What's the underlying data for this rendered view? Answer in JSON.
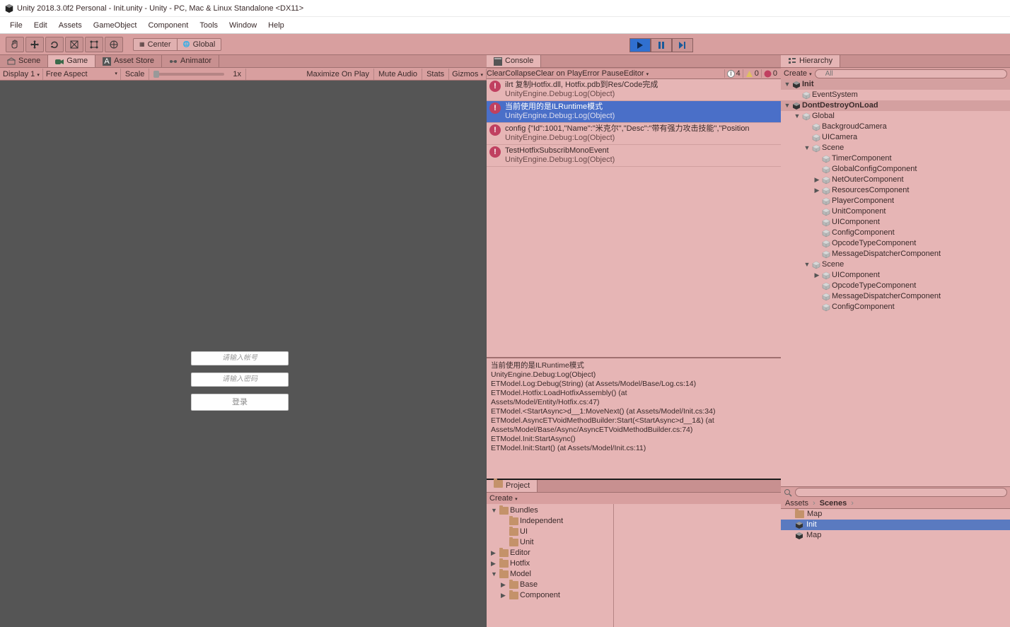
{
  "title": "Unity 2018.3.0f2 Personal - Init.unity - Unity - PC, Mac & Linux Standalone <DX11>",
  "menu": [
    "File",
    "Edit",
    "Assets",
    "GameObject",
    "Component",
    "Tools",
    "Window",
    "Help"
  ],
  "tool_pills": {
    "center": "Center",
    "global": "Global"
  },
  "left_tabs": [
    "Scene",
    "Game",
    "Asset Store",
    "Animator"
  ],
  "left_active_tab": 1,
  "game_bar": {
    "display": "Display 1",
    "aspect": "Free Aspect",
    "scale_label": "Scale",
    "scale_val": "1x",
    "max": "Maximize On Play",
    "mute": "Mute Audio",
    "stats": "Stats",
    "gizmos": "Gizmos"
  },
  "login": {
    "user_ph": "请输入帐号",
    "pass_ph": "请输入密码",
    "btn": "登录"
  },
  "console": {
    "tab": "Console",
    "btns": [
      "Clear",
      "Collapse",
      "Clear on Play",
      "Error Pause",
      "Editor"
    ],
    "counts": {
      "info": "4",
      "warn": "0",
      "err": "0"
    },
    "msgs": [
      {
        "t": "ilrt 复制Hotfix.dll, Hotfix.pdb到Res/Code完成",
        "s": "UnityEngine.Debug:Log(Object)"
      },
      {
        "t": "当前使用的是ILRuntime模式",
        "s": "UnityEngine.Debug:Log(Object)",
        "sel": true
      },
      {
        "t": "config {\"Id\":1001,\"Name\":\"米克尔\",\"Desc\":\"带有强力攻击技能\",\"Position",
        "s": "UnityEngine.Debug:Log(Object)"
      },
      {
        "t": "TestHotfixSubscribMonoEvent",
        "s": "UnityEngine.Debug:Log(Object)"
      }
    ],
    "detail": "当前使用的是ILRuntime模式\nUnityEngine.Debug:Log(Object)\nETModel.Log:Debug(String) (at Assets/Model/Base/Log.cs:14)\nETModel.Hotfix:LoadHotfixAssembly() (at\nAssets/Model/Entity/Hotfix.cs:47)\nETModel.<StartAsync>d__1:MoveNext() (at Assets/Model/Init.cs:34)\nETModel.AsyncETVoidMethodBuilder:Start(<StartAsync>d__1&) (at\nAssets/Model/Base/Async/AsyncETVoidMethodBuilder.cs:74)\nETModel.Init:StartAsync()\nETModel.Init:Start() (at Assets/Model/Init.cs:11)"
  },
  "project": {
    "tab": "Project",
    "create": "Create",
    "tree": [
      {
        "n": "Bundles",
        "d": 0,
        "e": "▼"
      },
      {
        "n": "Independent",
        "d": 1
      },
      {
        "n": "UI",
        "d": 1
      },
      {
        "n": "Unit",
        "d": 1
      },
      {
        "n": "Editor",
        "d": 0,
        "e": "▶"
      },
      {
        "n": "Hotfix",
        "d": 0,
        "e": "▶"
      },
      {
        "n": "Model",
        "d": 0,
        "e": "▼"
      },
      {
        "n": "Base",
        "d": 1,
        "e": "▶"
      },
      {
        "n": "Component",
        "d": 1,
        "e": "▶"
      }
    ],
    "crumb": [
      "Assets",
      "Scenes"
    ],
    "assets": [
      {
        "n": "Map",
        "t": "folder"
      },
      {
        "n": "Init",
        "t": "scene",
        "sel": true
      },
      {
        "n": "Map",
        "t": "scene"
      }
    ]
  },
  "hierarchy": {
    "tab": "Hierarchy",
    "create": "Create",
    "search_ph": "All",
    "items": [
      {
        "n": "Init",
        "d": 0,
        "e": "▼",
        "root": true
      },
      {
        "n": "EventSystem",
        "d": 1
      },
      {
        "n": "DontDestroyOnLoad",
        "d": 0,
        "e": "▼",
        "root": true
      },
      {
        "n": "Global",
        "d": 1,
        "e": "▼"
      },
      {
        "n": "BackgroudCamera",
        "d": 2
      },
      {
        "n": "UICamera",
        "d": 2
      },
      {
        "n": "Scene",
        "d": 2,
        "e": "▼"
      },
      {
        "n": "TimerComponent",
        "d": 3
      },
      {
        "n": "GlobalConfigComponent",
        "d": 3
      },
      {
        "n": "NetOuterComponent",
        "d": 3,
        "e": "▶"
      },
      {
        "n": "ResourcesComponent",
        "d": 3,
        "e": "▶"
      },
      {
        "n": "PlayerComponent",
        "d": 3
      },
      {
        "n": "UnitComponent",
        "d": 3
      },
      {
        "n": "UIComponent",
        "d": 3
      },
      {
        "n": "ConfigComponent",
        "d": 3
      },
      {
        "n": "OpcodeTypeComponent",
        "d": 3
      },
      {
        "n": "MessageDispatcherComponent",
        "d": 3
      },
      {
        "n": "Scene",
        "d": 2,
        "e": "▼"
      },
      {
        "n": "UIComponent",
        "d": 3,
        "e": "▶"
      },
      {
        "n": "OpcodeTypeComponent",
        "d": 3
      },
      {
        "n": "MessageDispatcherComponent",
        "d": 3
      },
      {
        "n": "ConfigComponent",
        "d": 3
      }
    ]
  }
}
